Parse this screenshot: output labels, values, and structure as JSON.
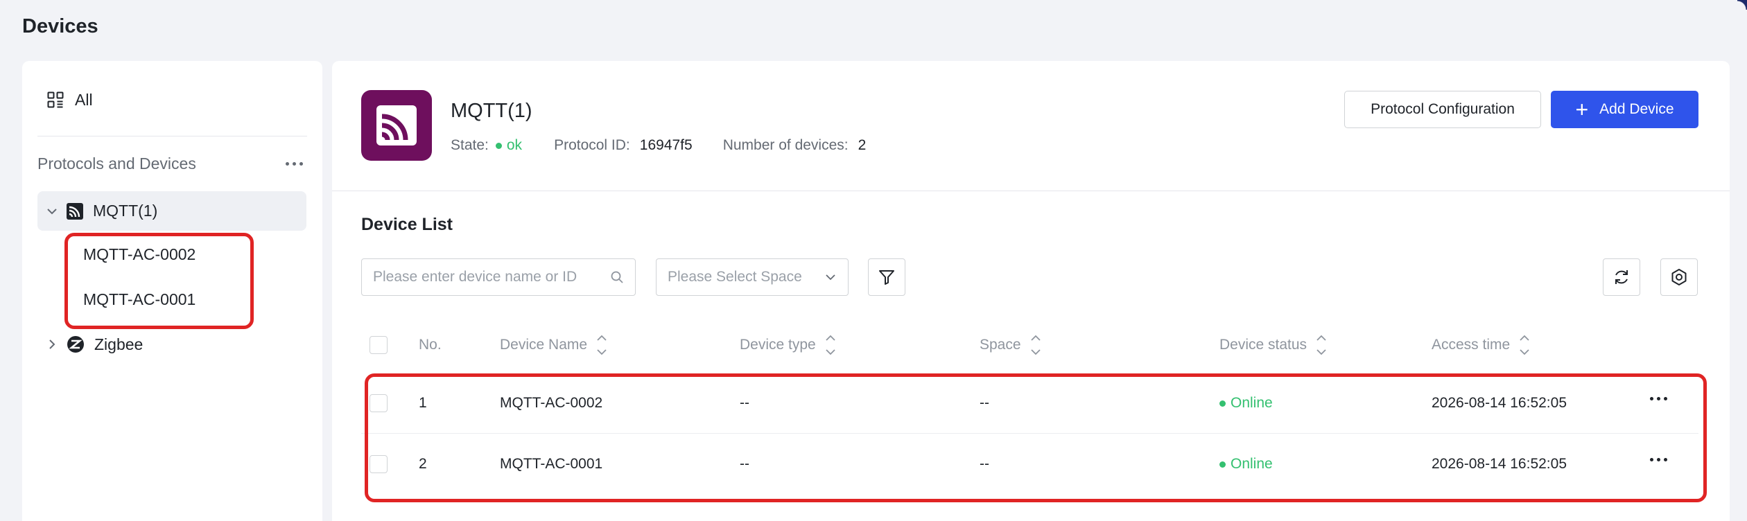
{
  "page": {
    "title": "Devices"
  },
  "sidebar": {
    "all_label": "All",
    "section_title": "Protocols and Devices",
    "protocols": [
      {
        "label": "MQTT(1)",
        "expanded": true,
        "icon": "mqtt-icon",
        "children": [
          "MQTT-AC-0002",
          "MQTT-AC-0001"
        ]
      },
      {
        "label": "Zigbee",
        "expanded": false,
        "icon": "zigbee-icon",
        "children": []
      }
    ]
  },
  "protocol": {
    "name": "MQTT(1)",
    "state_label": "State:",
    "state_value": "ok",
    "protocol_id_label": "Protocol ID:",
    "protocol_id_value": "16947f5",
    "device_count_label": "Number of devices:",
    "device_count_value": "2",
    "config_button": "Protocol Configuration",
    "add_button": "Add Device"
  },
  "device_list": {
    "title": "Device List",
    "search_placeholder": "Please enter device name or ID",
    "space_placeholder": "Please Select Space",
    "columns": [
      "No.",
      "Device Name",
      "Device type",
      "Space",
      "Device status",
      "Access time"
    ],
    "rows": [
      {
        "no": "1",
        "name": "MQTT-AC-0002",
        "type": "--",
        "space": "--",
        "status": "Online",
        "access_time": "2026-08-14 16:52:05"
      },
      {
        "no": "2",
        "name": "MQTT-AC-0001",
        "type": "--",
        "space": "--",
        "status": "Online",
        "access_time": "2026-08-14 16:52:05"
      }
    ]
  },
  "colors": {
    "primary": "#2f54eb",
    "online": "#34c070",
    "mqtt_logo_bg": "#6e0f5d",
    "highlight": "#e02424"
  }
}
